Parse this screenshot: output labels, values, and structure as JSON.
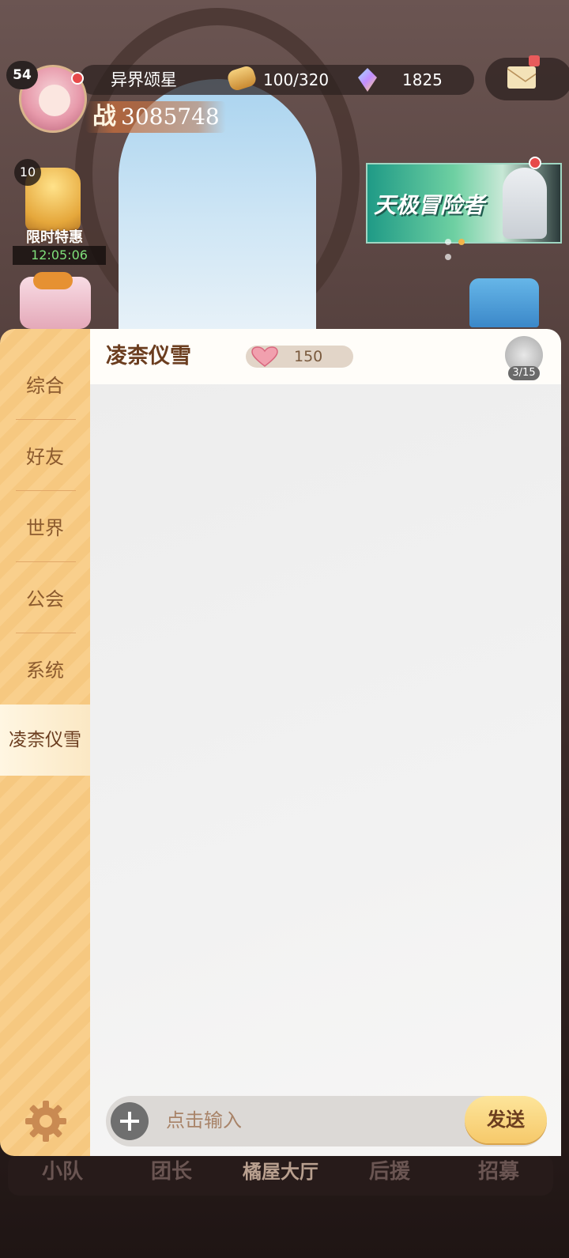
{
  "player": {
    "level": "54",
    "name": "异界颂星",
    "power_label": "战",
    "power_value": "3085748"
  },
  "resources": {
    "stamina": "100/320",
    "gems": "1825"
  },
  "promo": {
    "level": "10",
    "label": "限时特惠",
    "timer": "12:05:06"
  },
  "banner": {
    "title": "天极冒险者"
  },
  "sidebar": {
    "tabs": [
      {
        "label": "综合"
      },
      {
        "label": "好友"
      },
      {
        "label": "世界"
      },
      {
        "label": "公会"
      },
      {
        "label": "系统"
      },
      {
        "label": "凌柰仪雪"
      }
    ],
    "active_index": 5
  },
  "chat": {
    "title": "凌柰仪雪",
    "affinity": "150",
    "gift_count": "3/15",
    "input_placeholder": "点击输入",
    "send_label": "发送"
  },
  "bottom_nav": {
    "items": [
      {
        "label": "小队"
      },
      {
        "label": "团长"
      },
      {
        "label": "橘屋大厅"
      },
      {
        "label": "后援"
      },
      {
        "label": "招募"
      }
    ]
  },
  "colors": {
    "sidebar": "#f8cc87",
    "accent_text": "#6b3d1f",
    "send_button": "#f9d67d",
    "stamina_timer": "#7fe07a"
  }
}
